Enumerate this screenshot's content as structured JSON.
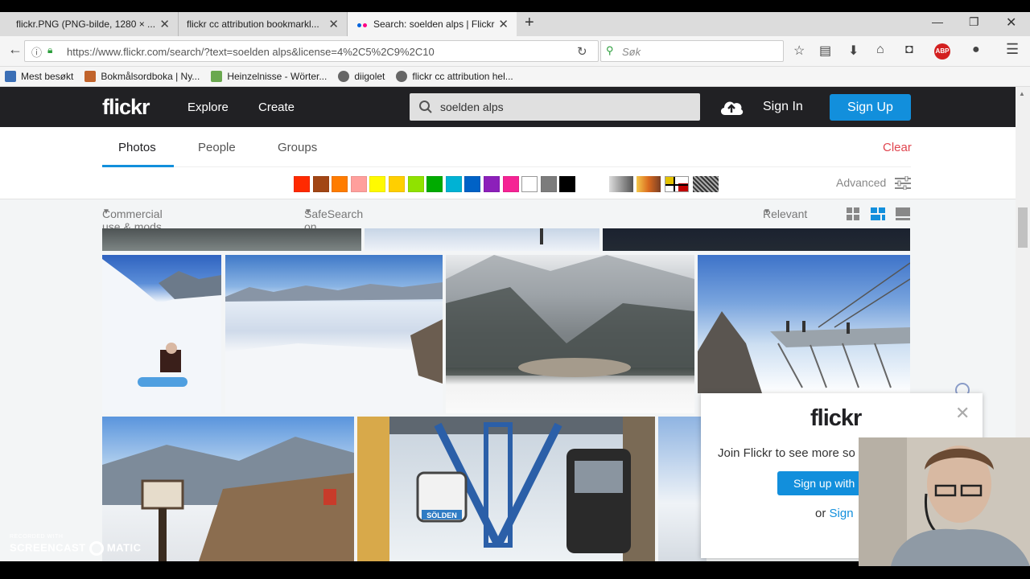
{
  "browser": {
    "tabs": [
      {
        "label": "flickr.PNG (PNG-bilde, 1280 × ...",
        "active": false
      },
      {
        "label": "flickr cc attribution bookmarkl...",
        "active": false
      },
      {
        "label": "Search: soelden alps | Flickr",
        "active": true
      }
    ],
    "url": "https://www.flickr.com/search/?text=soelden alps&license=4%2C5%2C9%2C10",
    "search_placeholder": "Søk",
    "bookmarks": [
      {
        "label": "Mest besøkt",
        "color": "#3b6fb6"
      },
      {
        "label": "Bokmålsordboka | Ny...",
        "color": "#c1632b"
      },
      {
        "label": "Heinzelnisse - Wörter...",
        "color": "#6aa84f"
      },
      {
        "label": "diigolet",
        "color": "#666666"
      },
      {
        "label": "flickr cc attribution hel...",
        "color": "#666666"
      }
    ]
  },
  "flickr": {
    "logo": "flickr",
    "nav": {
      "explore": "Explore",
      "create": "Create"
    },
    "search_value": "soelden alps",
    "sign_in": "Sign In",
    "sign_up": "Sign Up",
    "tabs": {
      "photos": "Photos",
      "people": "People",
      "groups": "Groups"
    },
    "clear": "Clear",
    "advanced": "Advanced",
    "colors": [
      "#ff2a00",
      "#a24615",
      "#ff7c00",
      "#ff9f9c",
      "#fffa00",
      "#ffcf00",
      "#90e200",
      "#00ab00",
      "#00b2d4",
      "#0062c6",
      "#8c20ba",
      "#f52394",
      "#ffffff",
      "#7c7c7c",
      "#000000"
    ],
    "filters": {
      "license": "Commercial use & mods allowed",
      "safesearch": "SafeSearch on",
      "sort": "Relevant"
    }
  },
  "popup": {
    "logo": "flickr",
    "text": "Join Flickr to see more so",
    "button": "Sign up with",
    "or_text": "or",
    "sign_link": "Sign"
  },
  "photos": {
    "gondola_sign": "SÖLDEN"
  },
  "watermark": {
    "line1": "RECORDED WITH",
    "line2": "SCREENCAST",
    "line3": "MATIC"
  }
}
